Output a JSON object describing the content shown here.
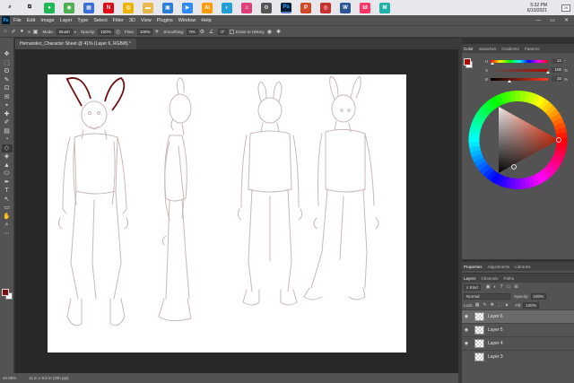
{
  "taskbar": {
    "icons": [
      {
        "name": "search-icon",
        "glyph": "⌕",
        "color": "#222222"
      },
      {
        "name": "task-view-icon",
        "glyph": "⧉",
        "color": "#222222"
      },
      {
        "name": "spotify-icon",
        "glyph": "●",
        "color": "#1db954"
      },
      {
        "name": "app-green-icon",
        "glyph": "◉",
        "color": "#4caf50"
      },
      {
        "name": "calendar-icon",
        "glyph": "▦",
        "color": "#3a6ed8"
      },
      {
        "name": "netflix-icon",
        "glyph": "N",
        "color": "#e50914"
      },
      {
        "name": "chrome-icon",
        "glyph": "◍",
        "color": "#f0b400"
      },
      {
        "name": "explorer-folder-icon",
        "glyph": "▬",
        "color": "#e8b84a"
      },
      {
        "name": "photos-icon",
        "glyph": "▣",
        "color": "#2a7fdc"
      },
      {
        "name": "zoom-icon",
        "glyph": "▶",
        "color": "#2d8cff"
      },
      {
        "name": "illustrator-icon",
        "glyph": "Ai",
        "color": "#ff9a00"
      },
      {
        "name": "edge-icon",
        "glyph": "◐",
        "color": "#1f9fd6"
      },
      {
        "name": "itunes-icon",
        "glyph": "♫",
        "color": "#e0407a"
      },
      {
        "name": "settings-gear-icon",
        "glyph": "⚙",
        "color": "#555555"
      },
      {
        "name": "photoshop-icon",
        "glyph": "Ps",
        "color": "#31a8ff"
      },
      {
        "name": "powerpoint-icon",
        "glyph": "P",
        "color": "#d24726"
      },
      {
        "name": "app-red-icon",
        "glyph": "◎",
        "color": "#c8302e"
      },
      {
        "name": "word-icon",
        "glyph": "W",
        "color": "#2b5797"
      },
      {
        "name": "indesign-icon",
        "glyph": "Id",
        "color": "#ff3366"
      },
      {
        "name": "app-teal-icon",
        "glyph": "M",
        "color": "#20b2aa"
      }
    ],
    "time": "5:32 PM",
    "date": "6/10/2021",
    "notification": "20"
  },
  "menubar": {
    "logo": "Ps",
    "items": [
      "File",
      "Edit",
      "Image",
      "Layer",
      "Type",
      "Select",
      "Filter",
      "3D",
      "View",
      "Plugins",
      "Window",
      "Help"
    ],
    "window_controls": [
      "—",
      "▭",
      "✕"
    ]
  },
  "options": {
    "mode_label": "Mode:",
    "mode_value": "Brush",
    "opacity_label": "Opacity:",
    "opacity_value": "100%",
    "flow_label": "Flow:",
    "flow_value": "100%",
    "smoothing_label": "Smoothing:",
    "smoothing_value": "0%",
    "angle_value": "0°",
    "erase_history": "Erase to History",
    "brush_size": "9"
  },
  "tools": [
    "✥",
    "⬚",
    "ʘ",
    "✎",
    "⊡",
    "✉",
    "⌖",
    "✚",
    "✐",
    "▤",
    "◔",
    "◇",
    "◈",
    "▲",
    "⬭",
    "✒",
    "T",
    "↖",
    "▭",
    "✋",
    "⌕",
    "⋯"
  ],
  "document": {
    "tab_title": "Hernandez_Character Sheet @ 41% (Layer 6, RGB/8) *",
    "close": "✕"
  },
  "status": {
    "zoom": "40.99%",
    "info": "11 in x 8.5 in (300 ppi)"
  },
  "color_panel": {
    "tabs": [
      "Color",
      "Swatches",
      "Gradients",
      "Patterns"
    ],
    "h_label": "H",
    "h_value": "12",
    "h_unit": "°",
    "s_label": "S",
    "s_value": "100",
    "s_unit": "%",
    "b_label": "B",
    "b_value": "33",
    "b_unit": "%",
    "foreground": "#a80d00",
    "h_frac": 0.03,
    "s_frac": 1.0,
    "b_frac": 0.33
  },
  "props_panel": {
    "tabs": [
      "Properties",
      "Adjustments",
      "Libraries"
    ]
  },
  "layers_panel": {
    "tabs": [
      "Layers",
      "Channels",
      "Paths"
    ],
    "kind_label": "Kind",
    "blend_mode": "Normal",
    "opacity_label": "Opacity:",
    "opacity_value": "100%",
    "lock_label": "Lock:",
    "fill_label": "Fill:",
    "fill_value": "100%",
    "layers": [
      {
        "name": "Layer 6",
        "visible": true,
        "selected": true
      },
      {
        "name": "Layer 5",
        "visible": true,
        "selected": false
      },
      {
        "name": "Layer 4",
        "visible": true,
        "selected": false
      },
      {
        "name": "Layer 3",
        "visible": false,
        "selected": false
      }
    ]
  }
}
